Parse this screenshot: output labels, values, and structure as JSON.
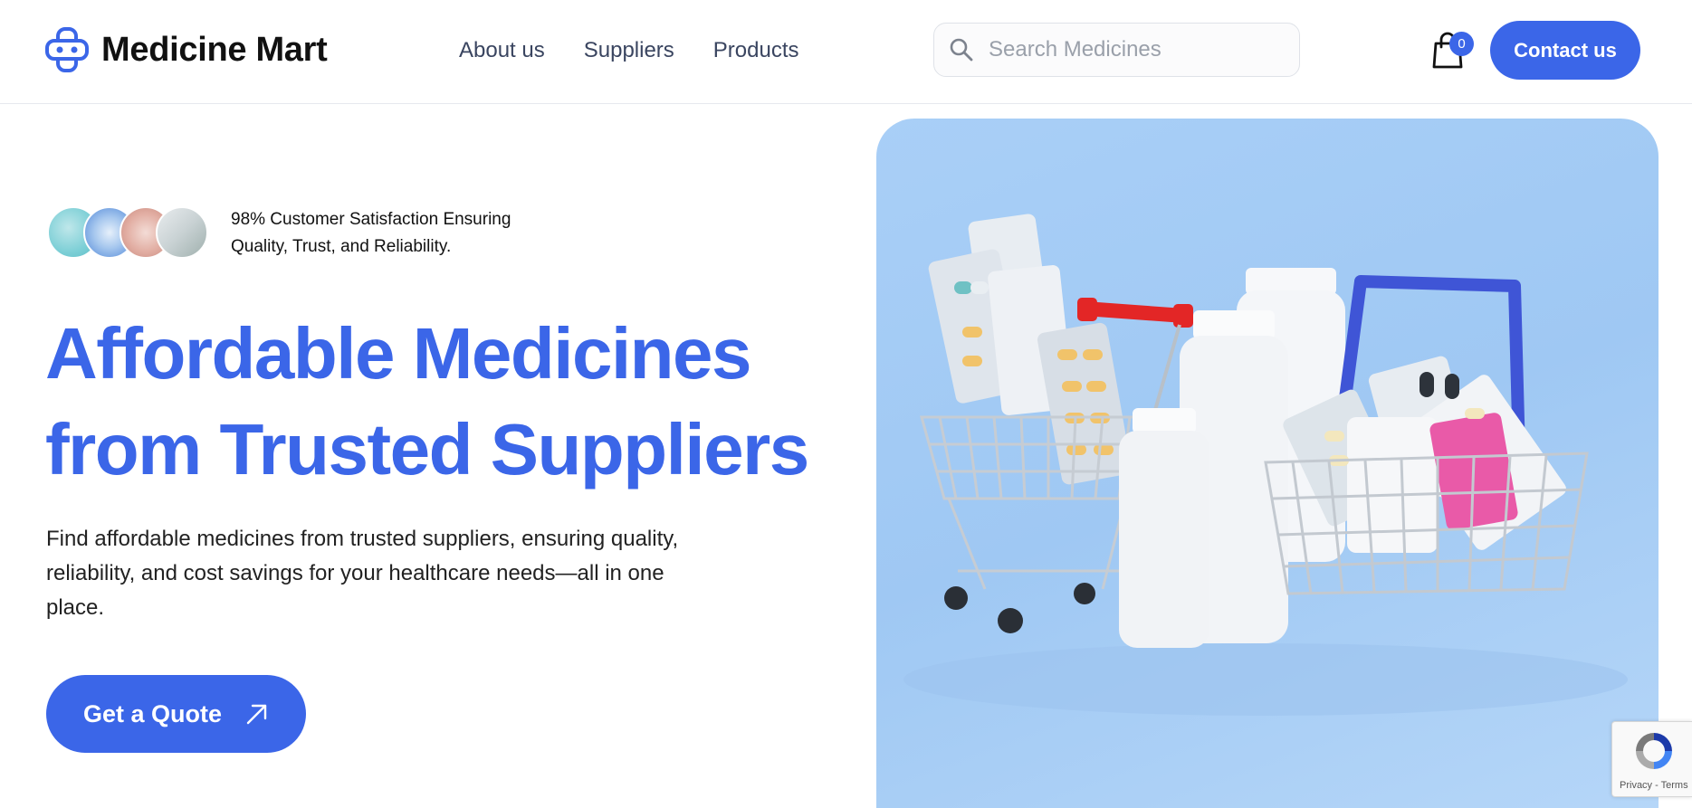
{
  "brand": {
    "name": "Medicine Mart",
    "accent_color": "#3b66e8"
  },
  "nav": {
    "items": [
      {
        "label": "About us"
      },
      {
        "label": "Suppliers"
      },
      {
        "label": "Products"
      }
    ]
  },
  "search": {
    "placeholder": "Search Medicines",
    "value": ""
  },
  "cart": {
    "count": "0",
    "icon": "shopping-bag-icon"
  },
  "header": {
    "contact_label": "Contact us"
  },
  "hero": {
    "satisfaction_line1": "98% Customer Satisfaction Ensuring",
    "satisfaction_line2": "Quality, Trust, and Reliability.",
    "title_line1": "Affordable Medicines",
    "title_line2": "from Trusted Suppliers",
    "description": "Find affordable medicines from trusted suppliers, ensuring quality, reliability, and cost savings for your healthcare needs—all in one place.",
    "cta_label": "Get a Quote"
  },
  "recaptcha": {
    "links": "Privacy - Terms"
  }
}
